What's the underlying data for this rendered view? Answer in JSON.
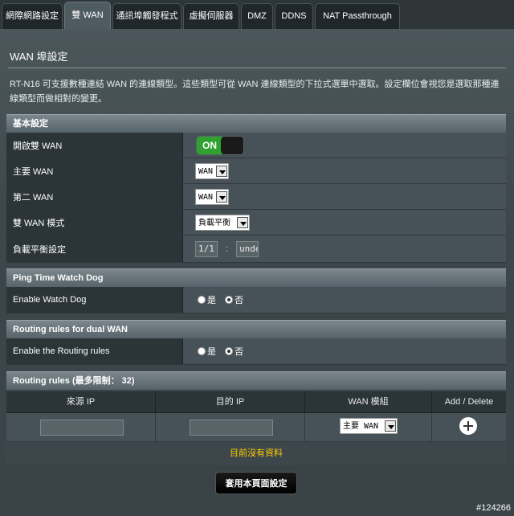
{
  "tabs": [
    {
      "label": "網際網路設定",
      "active": false
    },
    {
      "label": "雙 WAN",
      "active": true
    },
    {
      "label": "通訊埠觸發程式",
      "active": false
    },
    {
      "label": "虛擬伺服器",
      "active": false
    },
    {
      "label": "DMZ",
      "active": false
    },
    {
      "label": "DDNS",
      "active": false
    },
    {
      "label": "NAT Passthrough",
      "active": false
    }
  ],
  "page": {
    "title": "WAN 埠設定",
    "description": "RT-N16 可支援數種連結 WAN 的連線類型。這些類型可從 WAN 連線類型的下拉式選單中選取。設定欄位會視您是選取那種連線類型而做相對的變更。"
  },
  "basic": {
    "header": "基本設定",
    "enable_dual_wan": {
      "label": "開啟雙 WAN",
      "state": "ON"
    },
    "primary_wan": {
      "label": "主要 WAN",
      "value": "WAN"
    },
    "secondary_wan": {
      "label": "第二 WAN",
      "value": "WAN"
    },
    "dual_wan_mode": {
      "label": "雙 WAN 模式",
      "value": "負載平衡"
    },
    "load_balance": {
      "label": "負載平衡設定",
      "ratio_1": "1/1",
      "separator": ":",
      "ratio_2": "unde"
    }
  },
  "watchdog": {
    "header": "Ping Time Watch Dog",
    "enable": {
      "label": "Enable Watch Dog",
      "yes": "是",
      "no": "否",
      "selected": "no"
    }
  },
  "routing": {
    "header": "Routing rules for dual WAN",
    "enable": {
      "label": "Enable the Routing rules",
      "yes": "是",
      "no": "否",
      "selected": "no"
    }
  },
  "rules": {
    "header": "Routing rules (最多限制： 32)",
    "columns": [
      "來源 IP",
      "目的 IP",
      "WAN 模組",
      "Add / Delete"
    ],
    "new_row": {
      "source_ip": "",
      "dest_ip": "",
      "wan_module": "主要 WAN"
    },
    "empty_text": "目前沒有資料"
  },
  "apply_label": "套用本頁面設定",
  "watermark": "#124266",
  "colors": {
    "accent_on": "#2ea12e",
    "no_data": "#ffcc00"
  }
}
